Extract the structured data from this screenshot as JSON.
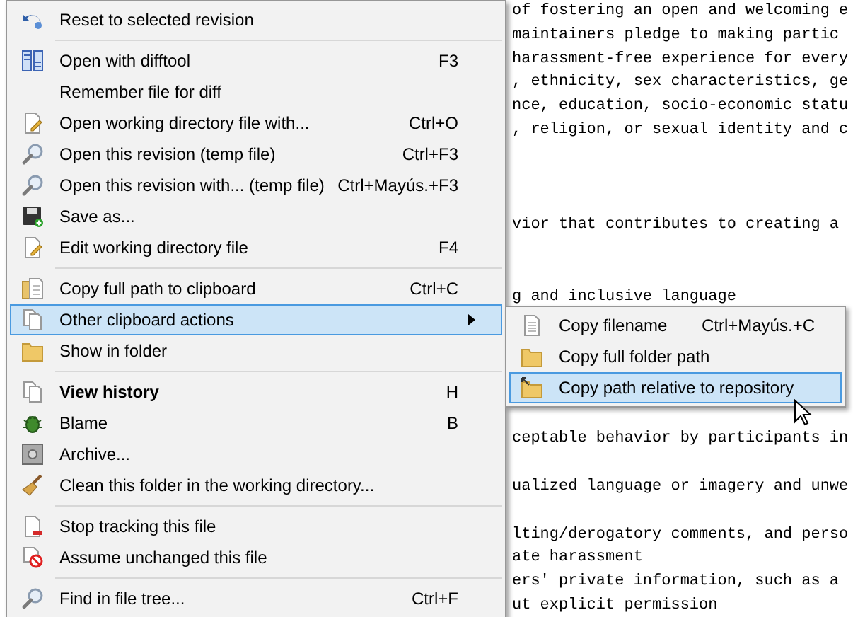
{
  "editor": {
    "lines": [
      {
        "kind": "text",
        "text": "of fostering an open and welcoming e"
      },
      {
        "kind": "text",
        "text": "maintainers pledge to making partic"
      },
      {
        "kind": "text",
        "text": "harassment-free experience for every"
      },
      {
        "kind": "text",
        "text": ", ethnicity, sex characteristics, ge"
      },
      {
        "kind": "text",
        "text": "nce, education, socio-economic statu"
      },
      {
        "kind": "text",
        "text": ", religion, or sexual identity and c"
      },
      {
        "kind": "blank"
      },
      {
        "kind": "blank"
      },
      {
        "kind": "blank"
      },
      {
        "kind": "text",
        "text": "vior that contributes to creating a"
      },
      {
        "kind": "blank"
      },
      {
        "kind": "blank"
      },
      {
        "kind": "text",
        "text": "g and inclusive language"
      },
      {
        "kind": "blank"
      },
      {
        "kind": "blank"
      },
      {
        "kind": "blank"
      },
      {
        "kind": "blank"
      },
      {
        "kind": "blank"
      },
      {
        "kind": "text",
        "text": "ceptable behavior by participants in"
      },
      {
        "kind": "blank"
      },
      {
        "kind": "text",
        "text": "ualized language or imagery and unwe"
      },
      {
        "kind": "blank"
      },
      {
        "kind": "text",
        "text": "lting/derogatory comments, and perso"
      },
      {
        "kind": "text",
        "text": "ate harassment"
      },
      {
        "kind": "text",
        "text": "ers' private information, such as a"
      },
      {
        "kind": "text",
        "text": "ut explicit permission"
      }
    ]
  },
  "context_menu": {
    "items": [
      {
        "kind": "item",
        "label": "Reset to selected revision",
        "selected": false,
        "bold": false,
        "submenu": false
      },
      {
        "kind": "separator"
      },
      {
        "kind": "item",
        "label": "Open with difftool",
        "shortcut": "F3",
        "selected": false,
        "bold": false,
        "submenu": false
      },
      {
        "kind": "item",
        "label": "Remember file for diff",
        "selected": false,
        "bold": false,
        "submenu": false
      },
      {
        "kind": "item",
        "label": "Open working directory file with...",
        "shortcut": "Ctrl+O",
        "selected": false,
        "bold": false,
        "submenu": false
      },
      {
        "kind": "item",
        "label": "Open this revision (temp file)",
        "shortcut": "Ctrl+F3",
        "selected": false,
        "bold": false,
        "submenu": false
      },
      {
        "kind": "item",
        "label": "Open this revision with... (temp file)",
        "shortcut": "Ctrl+Mayús.+F3",
        "selected": false,
        "bold": false,
        "submenu": false
      },
      {
        "kind": "item",
        "label": "Save as...",
        "selected": false,
        "bold": false,
        "submenu": false
      },
      {
        "kind": "item",
        "label": "Edit working directory file",
        "shortcut": "F4",
        "selected": false,
        "bold": false,
        "submenu": false
      },
      {
        "kind": "separator"
      },
      {
        "kind": "item",
        "label": "Copy full path to clipboard",
        "shortcut": "Ctrl+C",
        "selected": false,
        "bold": false,
        "submenu": false
      },
      {
        "kind": "item",
        "label": "Other clipboard actions",
        "selected": true,
        "bold": false,
        "submenu": true
      },
      {
        "kind": "item",
        "label": "Show in folder",
        "selected": false,
        "bold": false,
        "submenu": false
      },
      {
        "kind": "separator"
      },
      {
        "kind": "item",
        "label": "View history",
        "shortcut": "H",
        "selected": false,
        "bold": true,
        "submenu": false
      },
      {
        "kind": "item",
        "label": "Blame",
        "shortcut": "B",
        "selected": false,
        "bold": false,
        "submenu": false
      },
      {
        "kind": "item",
        "label": "Archive...",
        "selected": false,
        "bold": false,
        "submenu": false
      },
      {
        "kind": "item",
        "label": "Clean this folder in the working directory...",
        "selected": false,
        "bold": false,
        "submenu": false
      },
      {
        "kind": "separator"
      },
      {
        "kind": "item",
        "label": "Stop tracking this file",
        "selected": false,
        "bold": false,
        "submenu": false
      },
      {
        "kind": "item",
        "label": "Assume unchanged this file",
        "selected": false,
        "bold": false,
        "submenu": false
      },
      {
        "kind": "separator"
      },
      {
        "kind": "item",
        "label": "Find in file tree...",
        "shortcut": "Ctrl+F",
        "selected": false,
        "bold": false,
        "submenu": false
      }
    ]
  },
  "submenu": {
    "items": [
      {
        "kind": "item",
        "label": "Copy filename",
        "shortcut": "Ctrl+Mayús.+C",
        "selected": false
      },
      {
        "kind": "item",
        "label": "Copy full folder path",
        "selected": false
      },
      {
        "kind": "item",
        "label": "Copy path relative to repository",
        "selected": true
      }
    ]
  }
}
